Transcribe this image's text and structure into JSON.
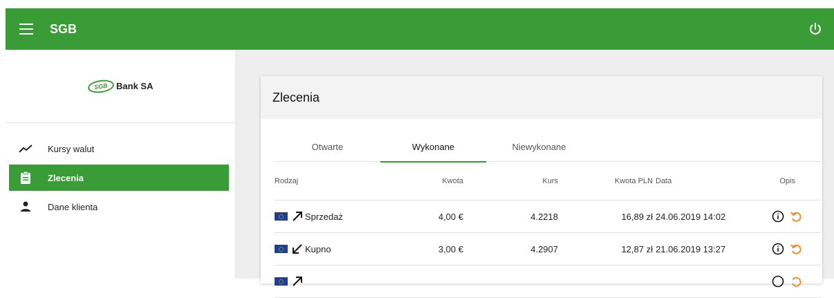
{
  "app": {
    "title": "SGB"
  },
  "logo": {
    "badge": "SGB",
    "name": "Bank SA"
  },
  "sidebar": {
    "items": [
      {
        "label": "Kursy walut",
        "icon": "trending-line-icon",
        "active": false
      },
      {
        "label": "Zlecenia",
        "icon": "clipboard-icon",
        "active": true
      },
      {
        "label": "Dane klienta",
        "icon": "person-icon",
        "active": false
      }
    ]
  },
  "card": {
    "title": "Zlecenia"
  },
  "tabs": [
    {
      "label": "Otwarte",
      "active": false
    },
    {
      "label": "Wykonane",
      "active": true
    },
    {
      "label": "Niewykonane",
      "active": false
    }
  ],
  "table": {
    "headers": {
      "rodzaj": "Rodzaj",
      "kwota": "Kwota",
      "kurs": "Kurs",
      "kwota_pln": "Kwota PLN",
      "data": "Data",
      "opis": "Opis"
    },
    "rows": [
      {
        "rodzaj": "Sprzedaż",
        "direction": "sell",
        "kwota": "4,00 €",
        "kurs": "4.2218",
        "kwota_pln": "16,89 zł",
        "data": "24.06.2019 14:02"
      },
      {
        "rodzaj": "Kupno",
        "direction": "buy",
        "kwota": "3,00 €",
        "kurs": "4.2907",
        "kwota_pln": "12,87 zł",
        "data": "21.06.2019 13:27"
      }
    ]
  },
  "colors": {
    "primary": "#3a9c36",
    "accent": "#f28c28",
    "flag": "#1d3f8f"
  }
}
